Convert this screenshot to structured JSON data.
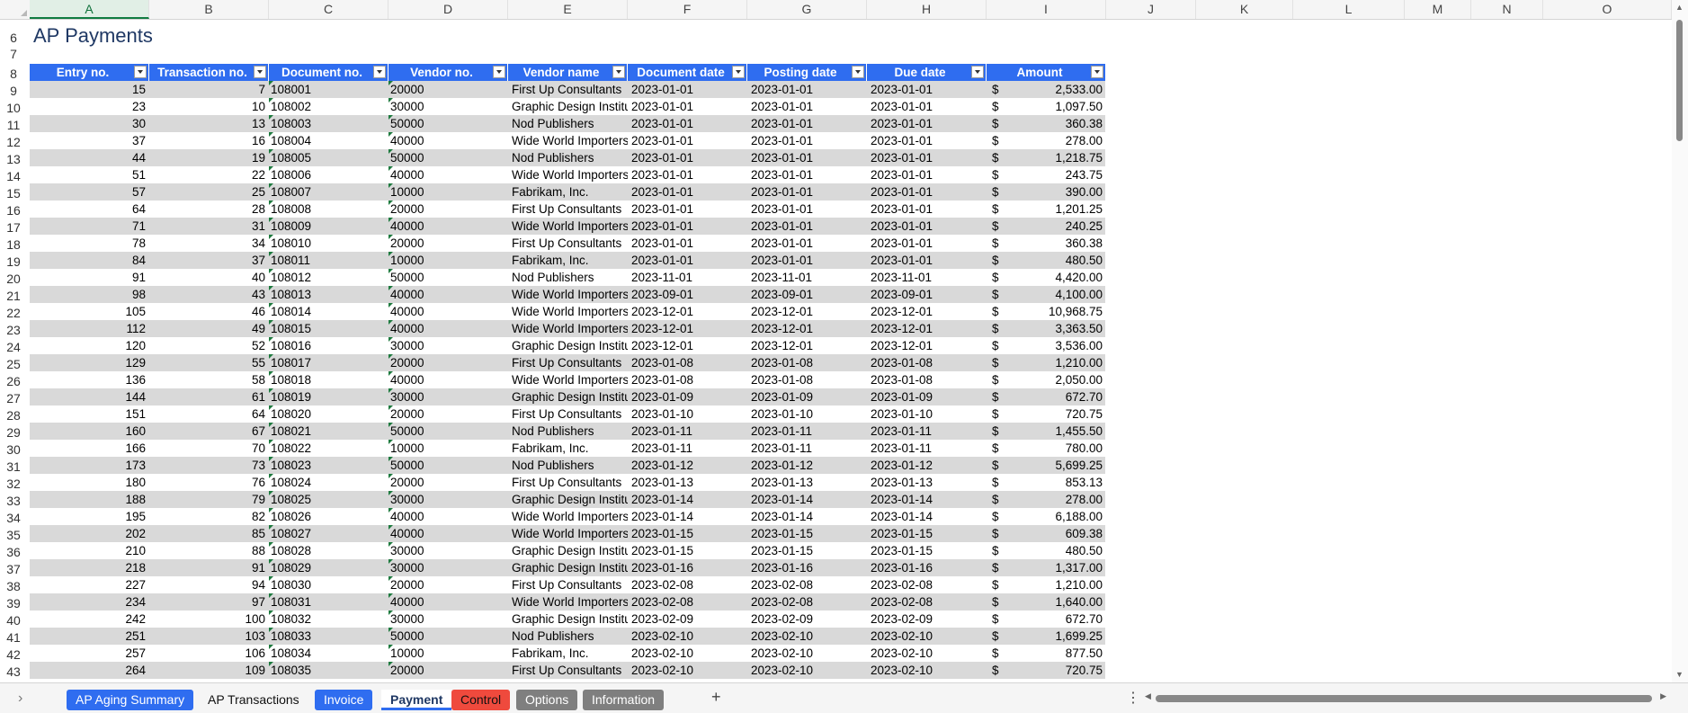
{
  "sheet": {
    "title": "AP Payments",
    "columns": [
      "A",
      "B",
      "C",
      "D",
      "E",
      "F",
      "G",
      "H",
      "I",
      "J",
      "K",
      "L",
      "M",
      "N",
      "O"
    ],
    "selected_column": "A",
    "visible_row_numbers": [
      6,
      7,
      8,
      9,
      10,
      11,
      12,
      13,
      14,
      15,
      16,
      17,
      18,
      19,
      20,
      21,
      22,
      23,
      24,
      25,
      26,
      27,
      28,
      29,
      30,
      31,
      32,
      33,
      34,
      35,
      36,
      37,
      38,
      39,
      40,
      41,
      42,
      43
    ],
    "table": {
      "headers": [
        "Entry no.",
        "Transaction no.",
        "Document no.",
        "Vendor no.",
        "Vendor name",
        "Document date",
        "Posting date",
        "Due date",
        "Amount"
      ],
      "currency_symbol": "$",
      "rows": [
        [
          "15",
          "7",
          "108001",
          "20000",
          "First Up Consultants",
          "2023-01-01",
          "2023-01-01",
          "2023-01-01",
          "2,533.00"
        ],
        [
          "23",
          "10",
          "108002",
          "30000",
          "Graphic Design Institute",
          "2023-01-01",
          "2023-01-01",
          "2023-01-01",
          "1,097.50"
        ],
        [
          "30",
          "13",
          "108003",
          "50000",
          "Nod Publishers",
          "2023-01-01",
          "2023-01-01",
          "2023-01-01",
          "360.38"
        ],
        [
          "37",
          "16",
          "108004",
          "40000",
          "Wide World Importers",
          "2023-01-01",
          "2023-01-01",
          "2023-01-01",
          "278.00"
        ],
        [
          "44",
          "19",
          "108005",
          "50000",
          "Nod Publishers",
          "2023-01-01",
          "2023-01-01",
          "2023-01-01",
          "1,218.75"
        ],
        [
          "51",
          "22",
          "108006",
          "40000",
          "Wide World Importers",
          "2023-01-01",
          "2023-01-01",
          "2023-01-01",
          "243.75"
        ],
        [
          "57",
          "25",
          "108007",
          "10000",
          "Fabrikam, Inc.",
          "2023-01-01",
          "2023-01-01",
          "2023-01-01",
          "390.00"
        ],
        [
          "64",
          "28",
          "108008",
          "20000",
          "First Up Consultants",
          "2023-01-01",
          "2023-01-01",
          "2023-01-01",
          "1,201.25"
        ],
        [
          "71",
          "31",
          "108009",
          "40000",
          "Wide World Importers",
          "2023-01-01",
          "2023-01-01",
          "2023-01-01",
          "240.25"
        ],
        [
          "78",
          "34",
          "108010",
          "20000",
          "First Up Consultants",
          "2023-01-01",
          "2023-01-01",
          "2023-01-01",
          "360.38"
        ],
        [
          "84",
          "37",
          "108011",
          "10000",
          "Fabrikam, Inc.",
          "2023-01-01",
          "2023-01-01",
          "2023-01-01",
          "480.50"
        ],
        [
          "91",
          "40",
          "108012",
          "50000",
          "Nod Publishers",
          "2023-11-01",
          "2023-11-01",
          "2023-11-01",
          "4,420.00"
        ],
        [
          "98",
          "43",
          "108013",
          "40000",
          "Wide World Importers",
          "2023-09-01",
          "2023-09-01",
          "2023-09-01",
          "4,100.00"
        ],
        [
          "105",
          "46",
          "108014",
          "40000",
          "Wide World Importers",
          "2023-12-01",
          "2023-12-01",
          "2023-12-01",
          "10,968.75"
        ],
        [
          "112",
          "49",
          "108015",
          "40000",
          "Wide World Importers",
          "2023-12-01",
          "2023-12-01",
          "2023-12-01",
          "3,363.50"
        ],
        [
          "120",
          "52",
          "108016",
          "30000",
          "Graphic Design Institute",
          "2023-12-01",
          "2023-12-01",
          "2023-12-01",
          "3,536.00"
        ],
        [
          "129",
          "55",
          "108017",
          "20000",
          "First Up Consultants",
          "2023-01-08",
          "2023-01-08",
          "2023-01-08",
          "1,210.00"
        ],
        [
          "136",
          "58",
          "108018",
          "40000",
          "Wide World Importers",
          "2023-01-08",
          "2023-01-08",
          "2023-01-08",
          "2,050.00"
        ],
        [
          "144",
          "61",
          "108019",
          "30000",
          "Graphic Design Institute",
          "2023-01-09",
          "2023-01-09",
          "2023-01-09",
          "672.70"
        ],
        [
          "151",
          "64",
          "108020",
          "20000",
          "First Up Consultants",
          "2023-01-10",
          "2023-01-10",
          "2023-01-10",
          "720.75"
        ],
        [
          "160",
          "67",
          "108021",
          "50000",
          "Nod Publishers",
          "2023-01-11",
          "2023-01-11",
          "2023-01-11",
          "1,455.50"
        ],
        [
          "166",
          "70",
          "108022",
          "10000",
          "Fabrikam, Inc.",
          "2023-01-11",
          "2023-01-11",
          "2023-01-11",
          "780.00"
        ],
        [
          "173",
          "73",
          "108023",
          "50000",
          "Nod Publishers",
          "2023-01-12",
          "2023-01-12",
          "2023-01-12",
          "5,699.25"
        ],
        [
          "180",
          "76",
          "108024",
          "20000",
          "First Up Consultants",
          "2023-01-13",
          "2023-01-13",
          "2023-01-13",
          "853.13"
        ],
        [
          "188",
          "79",
          "108025",
          "30000",
          "Graphic Design Institute",
          "2023-01-14",
          "2023-01-14",
          "2023-01-14",
          "278.00"
        ],
        [
          "195",
          "82",
          "108026",
          "40000",
          "Wide World Importers",
          "2023-01-14",
          "2023-01-14",
          "2023-01-14",
          "6,188.00"
        ],
        [
          "202",
          "85",
          "108027",
          "40000",
          "Wide World Importers",
          "2023-01-15",
          "2023-01-15",
          "2023-01-15",
          "609.38"
        ],
        [
          "210",
          "88",
          "108028",
          "30000",
          "Graphic Design Institute",
          "2023-01-15",
          "2023-01-15",
          "2023-01-15",
          "480.50"
        ],
        [
          "218",
          "91",
          "108029",
          "30000",
          "Graphic Design Institute",
          "2023-01-16",
          "2023-01-16",
          "2023-01-16",
          "1,317.00"
        ],
        [
          "227",
          "94",
          "108030",
          "20000",
          "First Up Consultants",
          "2023-02-08",
          "2023-02-08",
          "2023-02-08",
          "1,210.00"
        ],
        [
          "234",
          "97",
          "108031",
          "40000",
          "Wide World Importers",
          "2023-02-08",
          "2023-02-08",
          "2023-02-08",
          "1,640.00"
        ],
        [
          "242",
          "100",
          "108032",
          "30000",
          "Graphic Design Institute",
          "2023-02-09",
          "2023-02-09",
          "2023-02-09",
          "672.70"
        ],
        [
          "251",
          "103",
          "108033",
          "50000",
          "Nod Publishers",
          "2023-02-10",
          "2023-02-10",
          "2023-02-10",
          "1,699.25"
        ],
        [
          "257",
          "106",
          "108034",
          "10000",
          "Fabrikam, Inc.",
          "2023-02-10",
          "2023-02-10",
          "2023-02-10",
          "877.50"
        ],
        [
          "264",
          "109",
          "108035",
          "20000",
          "First Up Consultants",
          "2023-02-10",
          "2023-02-10",
          "2023-02-10",
          "720.75"
        ]
      ]
    }
  },
  "tabs": [
    {
      "label": "AP Aging Summary",
      "style": "blue",
      "active": false
    },
    {
      "label": "AP Transactions",
      "style": "plain",
      "active": false
    },
    {
      "label": "Invoice",
      "style": "blue",
      "active": false
    },
    {
      "label": "Payment",
      "style": "active",
      "active": true
    },
    {
      "label": "Control",
      "style": "red",
      "active": false
    },
    {
      "label": "Options",
      "style": "gray",
      "active": false
    },
    {
      "label": "Information",
      "style": "gray",
      "active": false
    }
  ],
  "icons": {
    "tab_nav": "chevron-right-icon",
    "add_sheet": "plus-icon",
    "more": "more-vertical-icon",
    "filter": "filter-dropdown-icon"
  },
  "colors": {
    "header_fill": "#2f6df0",
    "band_fill": "#d9d9d9",
    "title_text": "#1f3864",
    "selection_green": "#107c41"
  }
}
